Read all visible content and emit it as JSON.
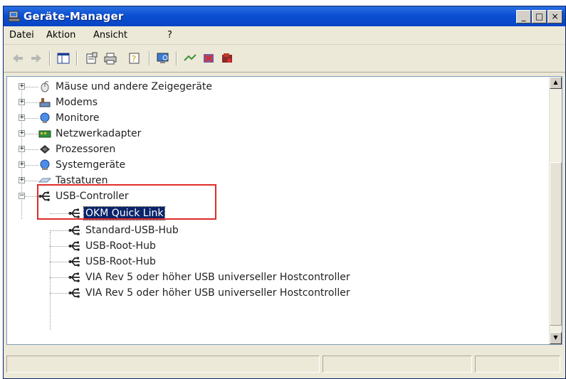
{
  "window": {
    "title": "Geräte-Manager",
    "controls": {
      "minimize": "_",
      "maximize": "□",
      "close": "×"
    }
  },
  "menu": {
    "items": [
      "Datei",
      "Aktion",
      "Ansicht",
      "?"
    ]
  },
  "toolbar": {
    "buttons": [
      "back-icon",
      "forward-icon",
      "console-tree-icon",
      "properties-icon",
      "print-icon",
      "help-icon",
      "scan-hardware-icon",
      "update-driver-icon",
      "uninstall-icon",
      "disable-icon"
    ]
  },
  "tree": {
    "items": [
      {
        "label": "Mäuse und andere Zeigegeräte",
        "icon": "mouse-icon",
        "level": 1,
        "expander": "+"
      },
      {
        "label": "Modems",
        "icon": "modem-icon",
        "level": 1,
        "expander": "+"
      },
      {
        "label": "Monitore",
        "icon": "monitor-icon",
        "level": 1,
        "expander": "+"
      },
      {
        "label": "Netzwerkadapter",
        "icon": "network-adapter-icon",
        "level": 1,
        "expander": "+"
      },
      {
        "label": "Prozessoren",
        "icon": "processor-icon",
        "level": 1,
        "expander": "+"
      },
      {
        "label": "Systemgeräte",
        "icon": "system-device-icon",
        "level": 1,
        "expander": "+"
      },
      {
        "label": "Tastaturen",
        "icon": "keyboard-icon",
        "level": 1,
        "expander": "+"
      },
      {
        "label": "USB-Controller",
        "icon": "usb-icon",
        "level": 1,
        "expander": "−"
      },
      {
        "label": "OKM Quick Link",
        "icon": "usb-icon",
        "level": 2,
        "selected": true
      },
      {
        "label": "Standard-USB-Hub",
        "icon": "usb-icon",
        "level": 2
      },
      {
        "label": "USB-Root-Hub",
        "icon": "usb-icon",
        "level": 2
      },
      {
        "label": "USB-Root-Hub",
        "icon": "usb-icon",
        "level": 2
      },
      {
        "label": "VIA Rev 5 oder höher USB universeller Hostcontroller",
        "icon": "usb-icon",
        "level": 2
      },
      {
        "label": "VIA Rev 5 oder höher USB universeller Hostcontroller",
        "icon": "usb-icon",
        "level": 2
      }
    ]
  },
  "colors": {
    "titlebar": "#0a4fd2",
    "selection": "#0a246a",
    "highlight_box": "#e02b2b"
  }
}
